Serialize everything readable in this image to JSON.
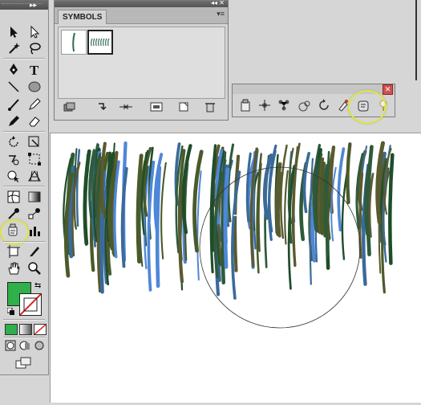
{
  "symbols_panel": {
    "tab_label": "SYMBOLS",
    "collapse_glyph": "◂◂",
    "close_glyph": "✕",
    "menu_glyph": "▾≡",
    "swatches": [
      "grass-blade-symbol",
      "grass-tuft-symbol"
    ],
    "buttons": [
      "symbol-libraries-menu-icon",
      "place-symbol-instance-icon",
      "break-link-icon",
      "symbol-options-icon",
      "new-symbol-icon",
      "delete-symbol-icon"
    ]
  },
  "toolbox": {
    "collapse_glyph": "▸▸",
    "accent_fill": "#2fb04a",
    "tools": [
      "selection-tool",
      "direct-selection-tool",
      "magic-wand-tool",
      "lasso-tool",
      "pen-tool",
      "type-tool",
      "line-segment-tool",
      "ellipse-tool",
      "paintbrush-tool",
      "pencil-tool",
      "blob-brush-tool",
      "eraser-tool",
      "rotate-tool",
      "scale-tool",
      "warp-tool",
      "free-transform-tool",
      "shape-builder-tool",
      "perspective-grid-tool",
      "mesh-tool",
      "gradient-tool",
      "eyedropper-tool",
      "blend-tool",
      "symbol-sprayer-tool",
      "column-graph-tool",
      "artboard-tool",
      "slice-tool",
      "hand-tool",
      "zoom-tool"
    ]
  },
  "sprayer_panel": {
    "close_glyph": "✕",
    "tools": [
      "symbol-sprayer-icon",
      "symbol-shifter-icon",
      "symbol-scruncher-icon",
      "symbol-sizer-icon",
      "symbol-spinner-icon",
      "symbol-stainer-icon",
      "symbol-screener-icon",
      "symbol-styler-icon"
    ],
    "highlight_color": "#dde44c"
  },
  "canvas": {
    "grass_colors": [
      "#2e5a3a",
      "#4a5a2a",
      "#3a6a9a",
      "#1f4d2a",
      "#5a5a30",
      "#4f87d8"
    ],
    "brush_circle": "visible"
  }
}
